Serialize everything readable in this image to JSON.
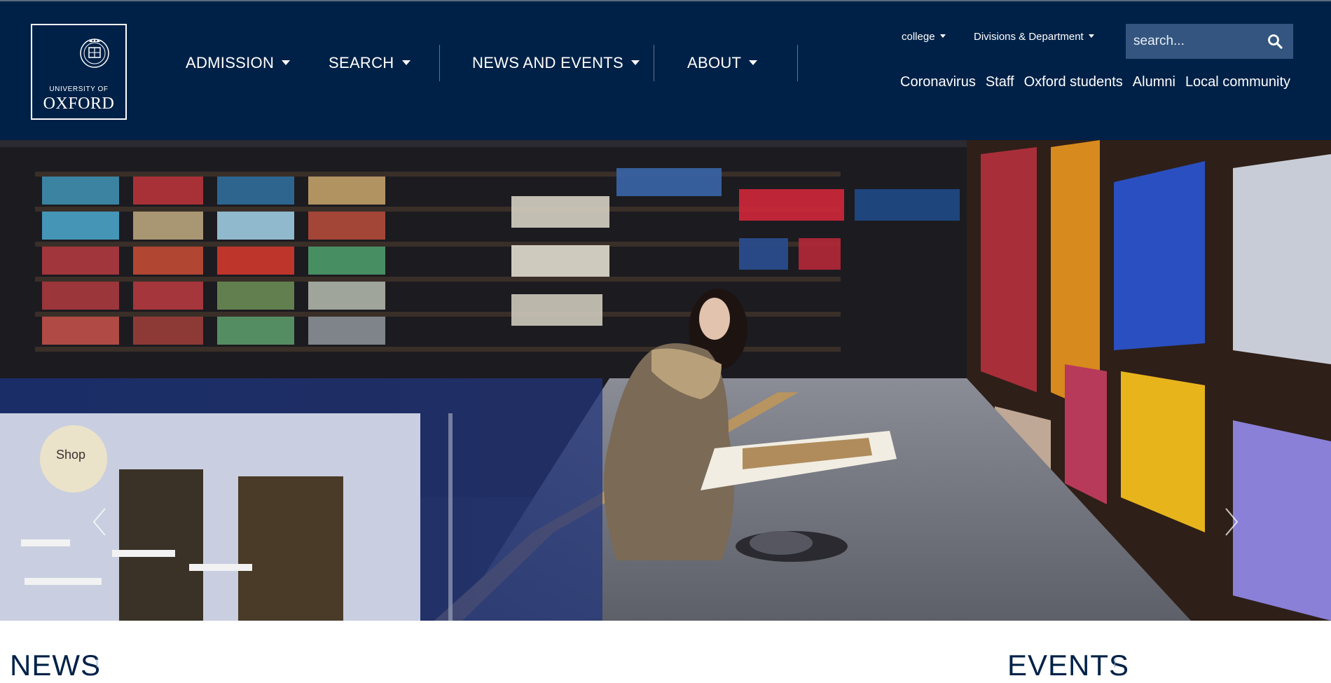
{
  "logo": {
    "line1": "UNIVERSITY OF",
    "line2": "OXFORD"
  },
  "nav": {
    "items": [
      {
        "label": "ADMISSION"
      },
      {
        "label": "SEARCH"
      },
      {
        "label": "NEWS AND EVENTS"
      },
      {
        "label": "ABOUT"
      }
    ]
  },
  "utility": {
    "college": "college",
    "divisions": "Divisions & Department"
  },
  "search": {
    "placeholder": "search..."
  },
  "quick_links": [
    "Coronavirus",
    "Staff",
    "Oxford students",
    "Alumni",
    "Local community"
  ],
  "sections": {
    "news": "NEWS",
    "events": "EVENTS"
  },
  "hero": {
    "shop_sign": "Shop"
  },
  "colors": {
    "header_bg": "#002147",
    "search_bg": "#33557f",
    "white": "#ffffff"
  }
}
